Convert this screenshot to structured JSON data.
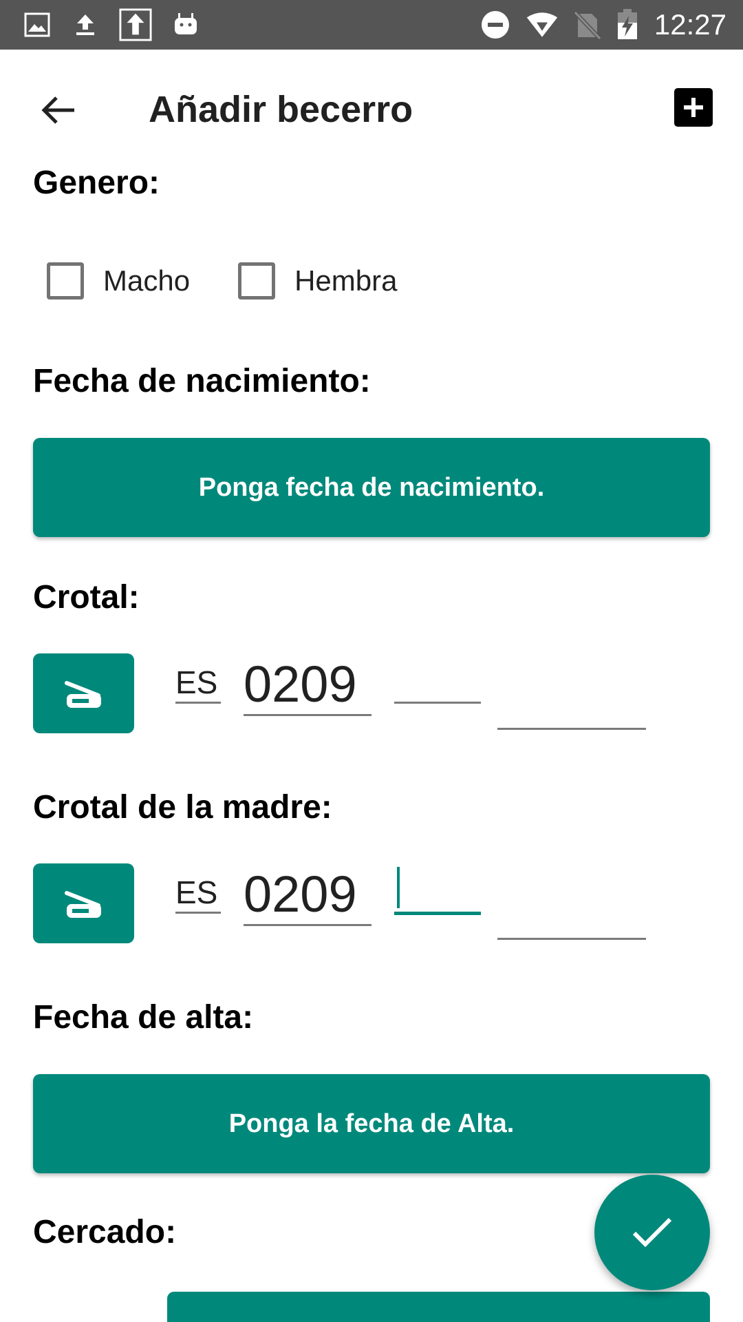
{
  "status_bar": {
    "time": "12:27",
    "left_icons": [
      "image-icon",
      "upload-icon",
      "upload-box-icon",
      "android-icon"
    ],
    "right_icons": [
      "do-not-disturb-icon",
      "wifi-icon",
      "no-sim-icon",
      "battery-charging-icon"
    ]
  },
  "app_bar": {
    "title": "Añadir becerro",
    "back_icon": "arrow-left-icon",
    "add_icon": "add-box-icon"
  },
  "gender": {
    "label": "Genero:",
    "options": [
      {
        "label": "Macho",
        "checked": false
      },
      {
        "label": "Hembra",
        "checked": false
      }
    ]
  },
  "birth_date": {
    "label": "Fecha de nacimiento:",
    "button": "Ponga fecha de nacimiento."
  },
  "ear_tag": {
    "label": "Crotal:",
    "scan_icon": "scanner-icon",
    "country": "ES",
    "prefix": "0209",
    "part3": "",
    "part4": ""
  },
  "mother_tag": {
    "label": "Crotal de la madre:",
    "scan_icon": "scanner-icon",
    "country": "ES",
    "prefix": "0209",
    "part3": "",
    "part4": ""
  },
  "registration_date": {
    "label": "Fecha de alta:",
    "button": "Ponga la fecha de Alta."
  },
  "enclosure": {
    "label": "Cercado:"
  },
  "fab_icon": "check-icon",
  "colors": {
    "accent": "#00897b",
    "status_bar": "#555555"
  }
}
